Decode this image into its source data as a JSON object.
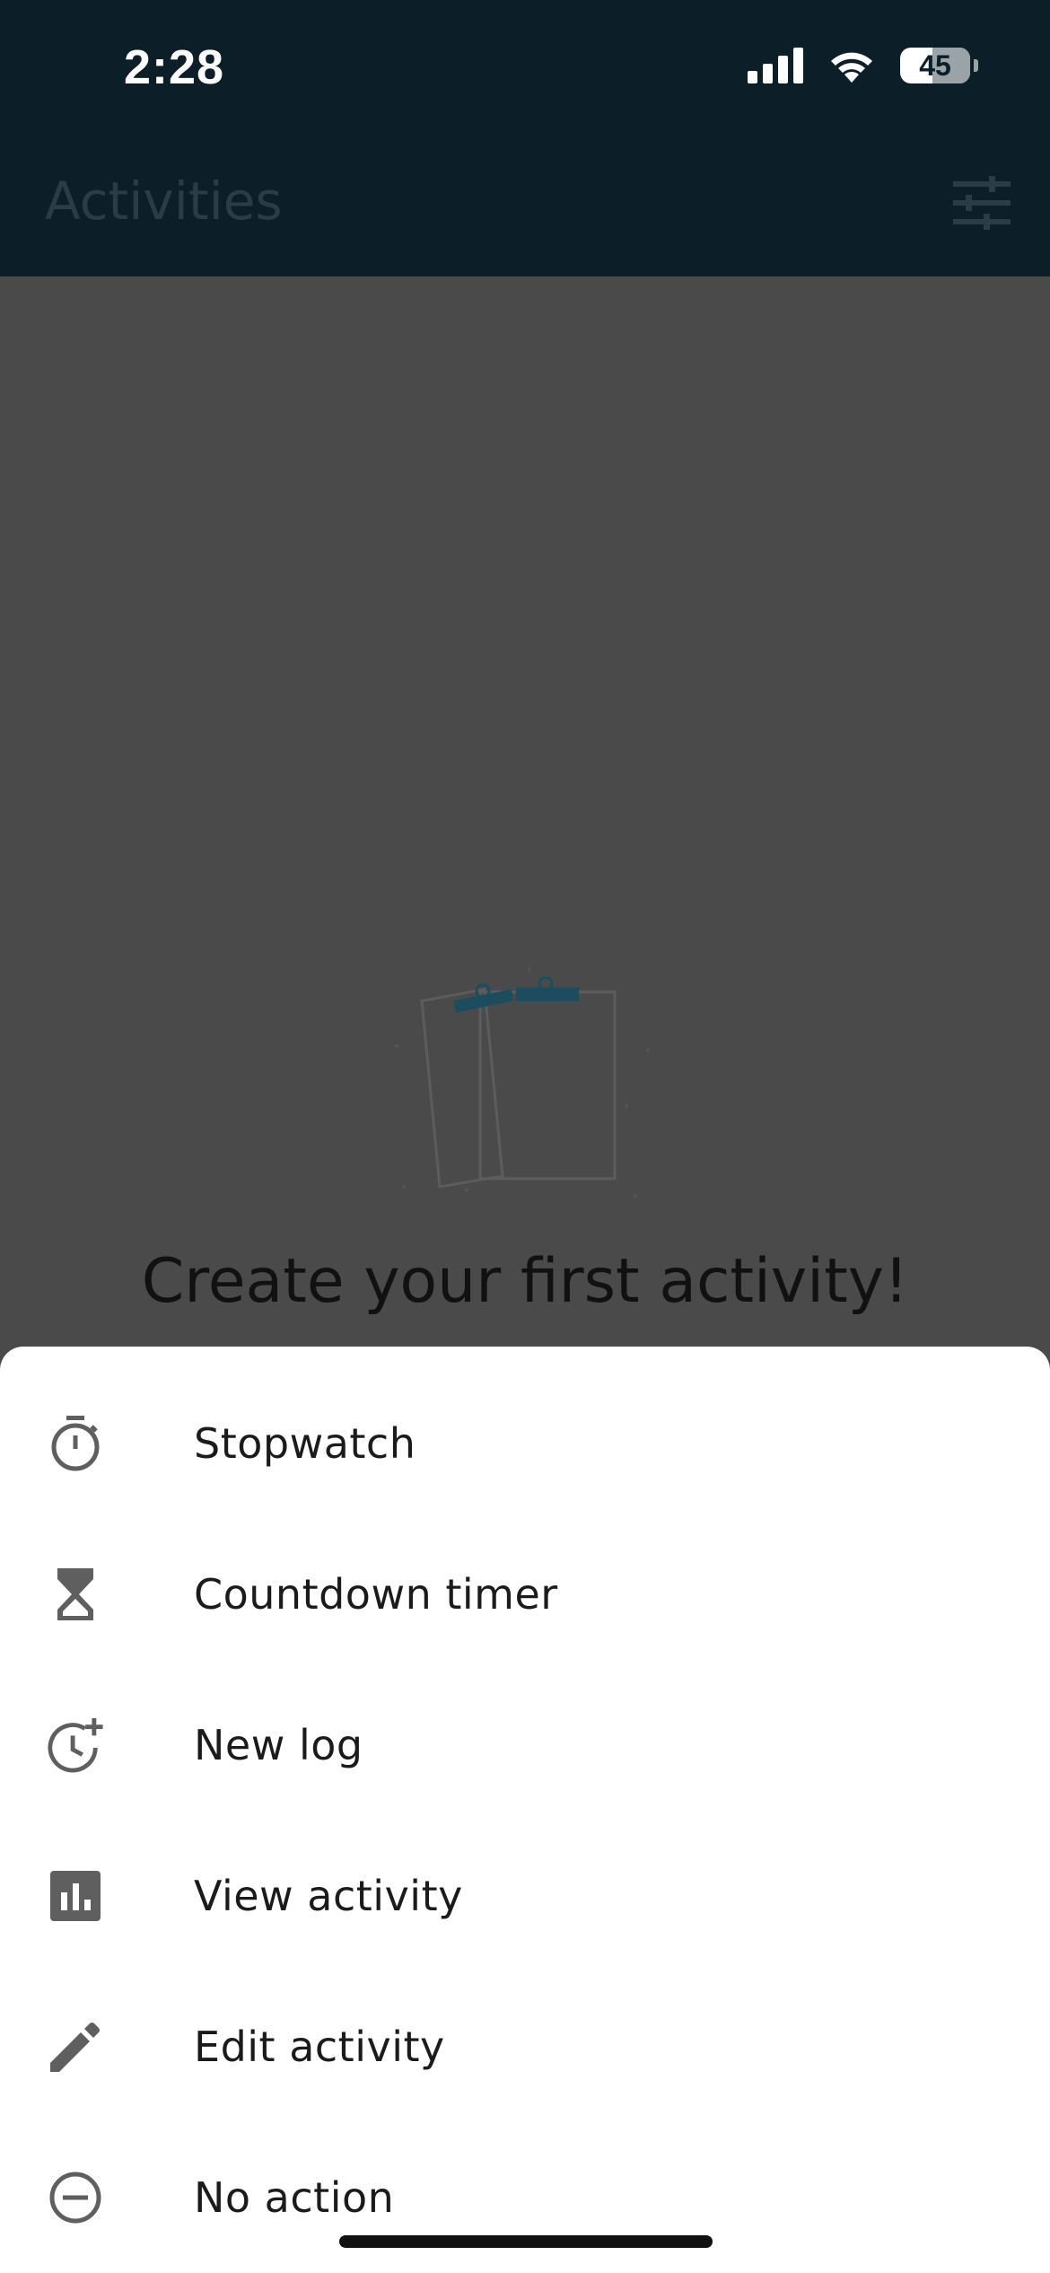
{
  "status_bar": {
    "time": "2:28",
    "battery": "45",
    "icons": [
      "cellular-signal-icon",
      "wifi-icon",
      "battery-icon"
    ]
  },
  "header": {
    "title": "Activities",
    "filter_icon": "tune-icon"
  },
  "empty_state": {
    "title": "Create your first activity!",
    "illustration": "clipboards-illustration"
  },
  "action_sheet": {
    "items": [
      {
        "label": "Stopwatch",
        "icon": "stopwatch-icon"
      },
      {
        "label": "Countdown timer",
        "icon": "hourglass-icon"
      },
      {
        "label": "New log",
        "icon": "clock-add-icon"
      },
      {
        "label": "View activity",
        "icon": "bar-chart-icon"
      },
      {
        "label": "Edit activity",
        "icon": "pencil-icon"
      },
      {
        "label": "No action",
        "icon": "minus-circle-icon"
      }
    ]
  },
  "colors": {
    "header_bg": "#0c1f29",
    "overlay_bg": "#4a4a4a",
    "accent": "#1b5c73",
    "sheet_bg": "#ffffff",
    "icon_color": "#5f5f5f"
  }
}
